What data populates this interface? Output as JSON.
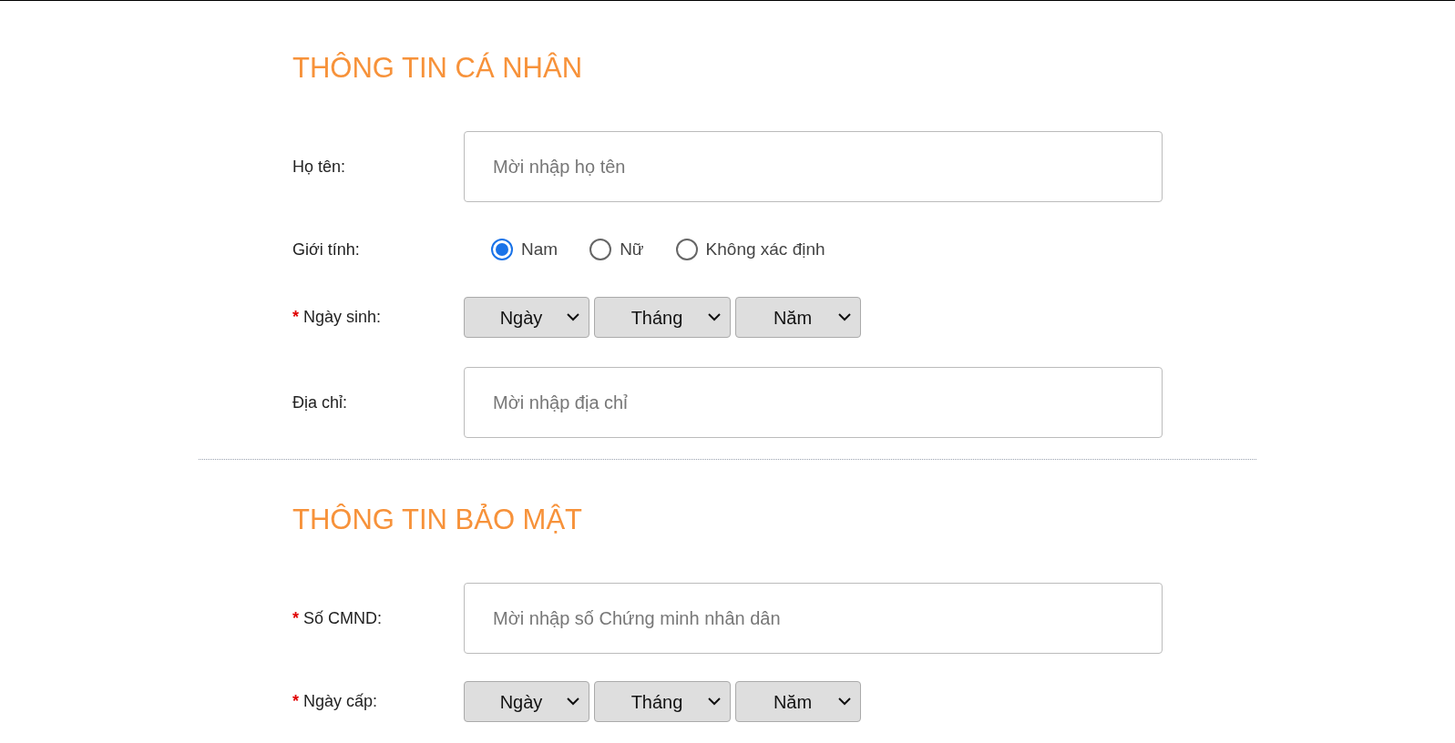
{
  "sections": [
    {
      "title": "THÔNG TIN CÁ NHÂN",
      "fields": [
        {
          "kind": "text",
          "label": "Họ tên:",
          "placeholder": "Mời nhập họ tên"
        },
        {
          "kind": "radio",
          "label": "Giới tính:",
          "options": [
            {
              "label": "Nam",
              "selected": true
            },
            {
              "label": "Nữ",
              "selected": false
            },
            {
              "label": "Không xác định",
              "selected": false
            }
          ]
        },
        {
          "kind": "date",
          "required_mark": "*",
          "label": "Ngày sinh:",
          "selects": [
            "Ngày",
            "Tháng",
            "Năm"
          ]
        },
        {
          "kind": "text",
          "label": "Địa chỉ:",
          "placeholder": "Mời nhập địa chỉ"
        }
      ]
    },
    {
      "title": "THÔNG TIN BẢO MẬT",
      "fields": [
        {
          "kind": "text",
          "required_mark": "*",
          "label": "Số CMND:",
          "placeholder": "Mời nhập số Chứng minh nhân dân"
        },
        {
          "kind": "date",
          "required_mark": "*",
          "label": "Ngày cấp:",
          "selects": [
            "Ngày",
            "Tháng",
            "Năm"
          ]
        }
      ]
    }
  ]
}
